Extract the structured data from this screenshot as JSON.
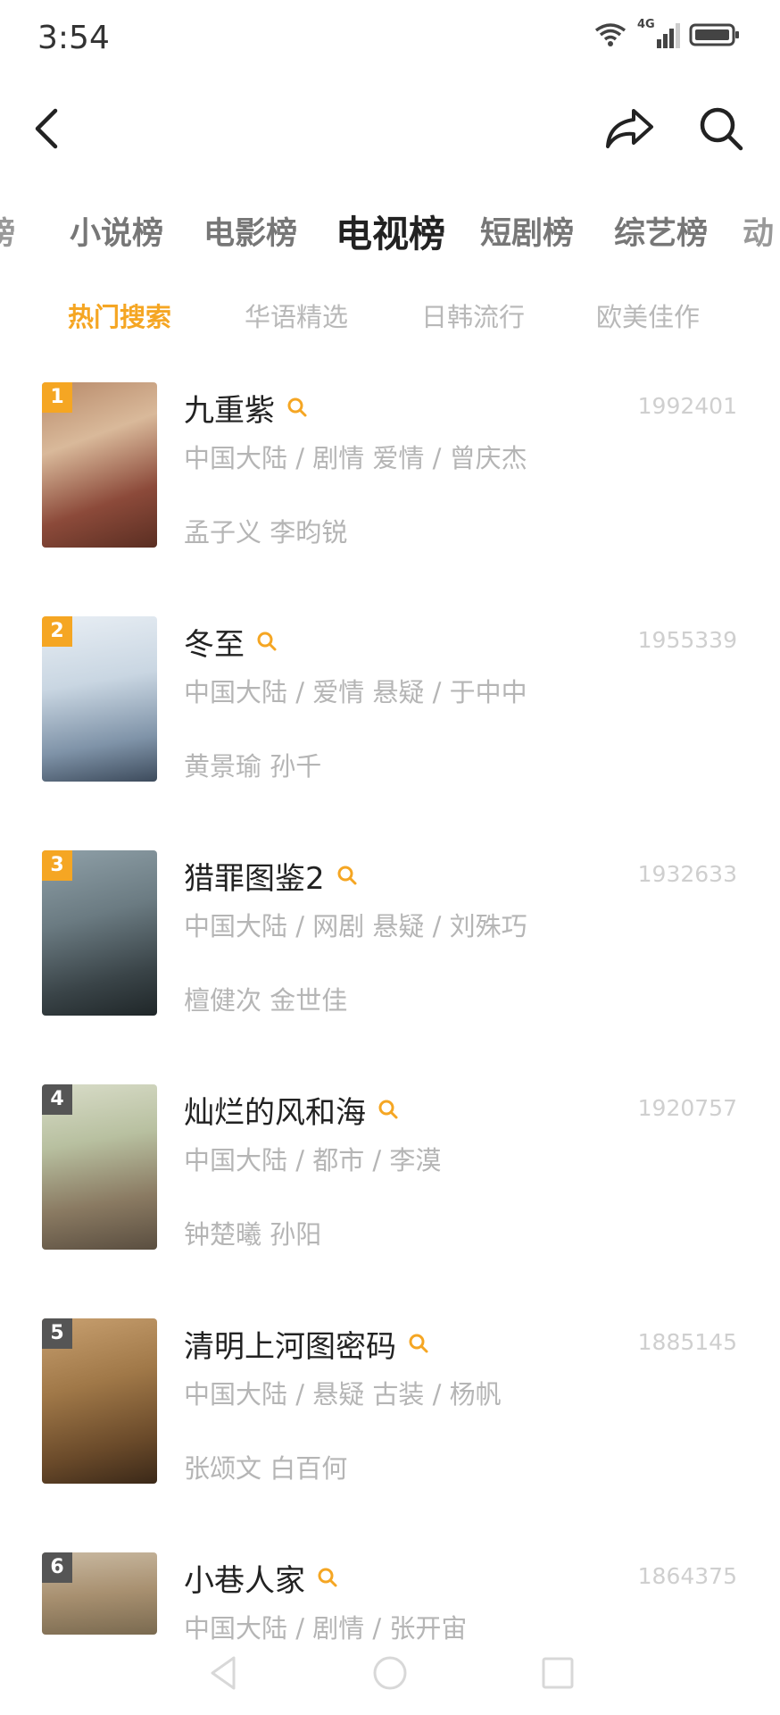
{
  "status": {
    "time": "3:54",
    "network": "4G"
  },
  "categories": [
    {
      "label": "小说榜",
      "active": false
    },
    {
      "label": "电影榜",
      "active": false
    },
    {
      "label": "电视榜",
      "active": true
    },
    {
      "label": "短剧榜",
      "active": false
    },
    {
      "label": "综艺榜",
      "active": false
    }
  ],
  "subtabs": [
    {
      "label": "热门搜索",
      "active": true
    },
    {
      "label": "华语精选",
      "active": false
    },
    {
      "label": "日韩流行",
      "active": false
    },
    {
      "label": "欧美佳作",
      "active": false
    }
  ],
  "items": [
    {
      "rank": "1",
      "title": "九重紫",
      "score": "1992401",
      "meta": "中国大陆 / 剧情 爱情 / 曾庆杰",
      "cast": "孟子义 李昀锐"
    },
    {
      "rank": "2",
      "title": "冬至",
      "score": "1955339",
      "meta": "中国大陆 / 爱情 悬疑 / 于中中",
      "cast": "黄景瑜 孙千"
    },
    {
      "rank": "3",
      "title": "猎罪图鉴2",
      "score": "1932633",
      "meta": "中国大陆 / 网剧 悬疑 / 刘殊巧",
      "cast": "檀健次 金世佳"
    },
    {
      "rank": "4",
      "title": "灿烂的风和海",
      "score": "1920757",
      "meta": "中国大陆 / 都市 / 李漠",
      "cast": "钟楚曦 孙阳"
    },
    {
      "rank": "5",
      "title": "清明上河图密码",
      "score": "1885145",
      "meta": "中国大陆 / 悬疑 古装 / 杨帆",
      "cast": "张颂文 白百何"
    },
    {
      "rank": "6",
      "title": "小巷人家",
      "score": "1864375",
      "meta": "中国大陆 / 剧情 / 张开宙",
      "cast": ""
    }
  ],
  "colors": {
    "accent": "#f5a623",
    "rank_top": "#f5a623",
    "rank_other": "#555555"
  }
}
